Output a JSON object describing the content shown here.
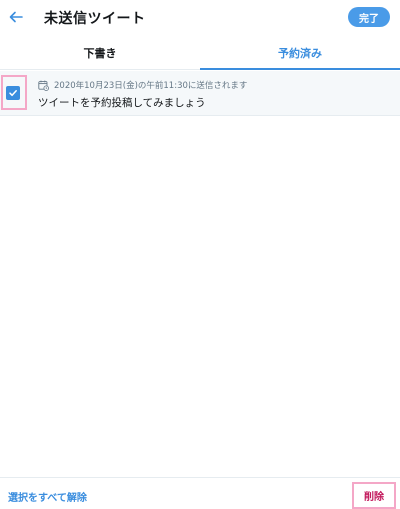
{
  "header": {
    "title": "未送信ツイート",
    "back_icon": "arrow-left-icon",
    "done_label": "完了"
  },
  "tabs": [
    {
      "label": "下書き",
      "active": false
    },
    {
      "label": "予約済み",
      "active": true
    }
  ],
  "scheduled_items": [
    {
      "checked": true,
      "calendar_icon": "calendar-clock-icon",
      "schedule_text": "2020年10月23日(金)の午前11:30に送信されます",
      "tweet_text": "ツイートを予約投稿してみましょう"
    }
  ],
  "footer": {
    "clear_selection_label": "選択をすべて解除",
    "delete_label": "削除"
  },
  "colors": {
    "accent": "#3a8dde",
    "highlight": "#f4a7c7",
    "delete": "#c2185b"
  }
}
